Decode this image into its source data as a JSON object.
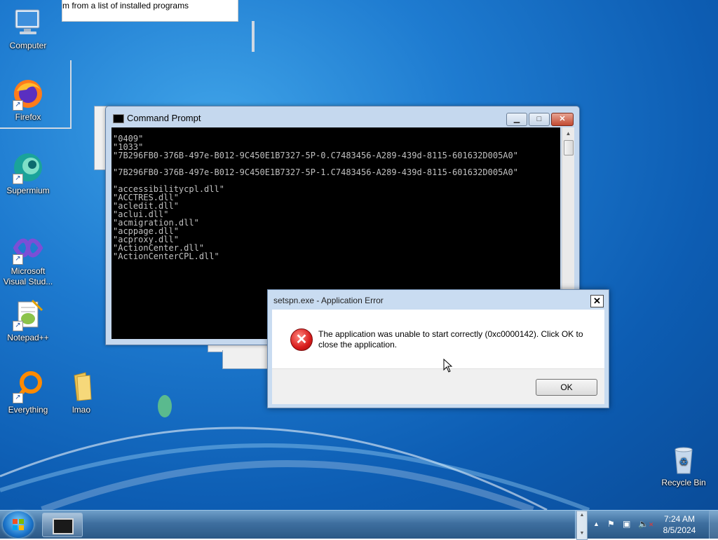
{
  "desktop": {
    "icons": [
      {
        "label": "Computer"
      },
      {
        "label": "Firefox"
      },
      {
        "label": "Supermium"
      },
      {
        "label": "Microsoft Visual Stud..."
      },
      {
        "label": "Notepad++"
      },
      {
        "label": "Everything"
      },
      {
        "label": "lmao"
      },
      {
        "label": "Recycle Bin"
      }
    ],
    "top_strip_text": "m from a list of installed programs"
  },
  "cmd_window": {
    "title": "Command Prompt",
    "console_text": "\"0409\"\n\"1033\"\n\"7B296FB0-376B-497e-B012-9C450E1B7327-5P-0.C7483456-A289-439d-8115-601632D005A0\"\n\n\"7B296FB0-376B-497e-B012-9C450E1B7327-5P-1.C7483456-A289-439d-8115-601632D005A0\"\n\n\"accessibilitycpl.dll\"\n\"ACCTRES.dll\"\n\"acledit.dll\"\n\"aclui.dll\"\n\"acmigration.dll\"\n\"acppage.dll\"\n\"acproxy.dll\"\n\"ActionCenter.dll\"\n\"ActionCenterCPL.dll\""
  },
  "error_dialog": {
    "title": "setspn.exe - Application Error",
    "message": "The application was unable to start correctly (0xc0000142). Click OK to close the application.",
    "ok_label": "OK",
    "close_glyph": "✕"
  },
  "taskbar": {
    "clock_time": "7:24 AM",
    "clock_date": "8/5/2024",
    "tray_icons": [
      "show-hidden-icons-icon",
      "action-center-flag-icon",
      "network-icon",
      "volume-muted-icon"
    ]
  }
}
